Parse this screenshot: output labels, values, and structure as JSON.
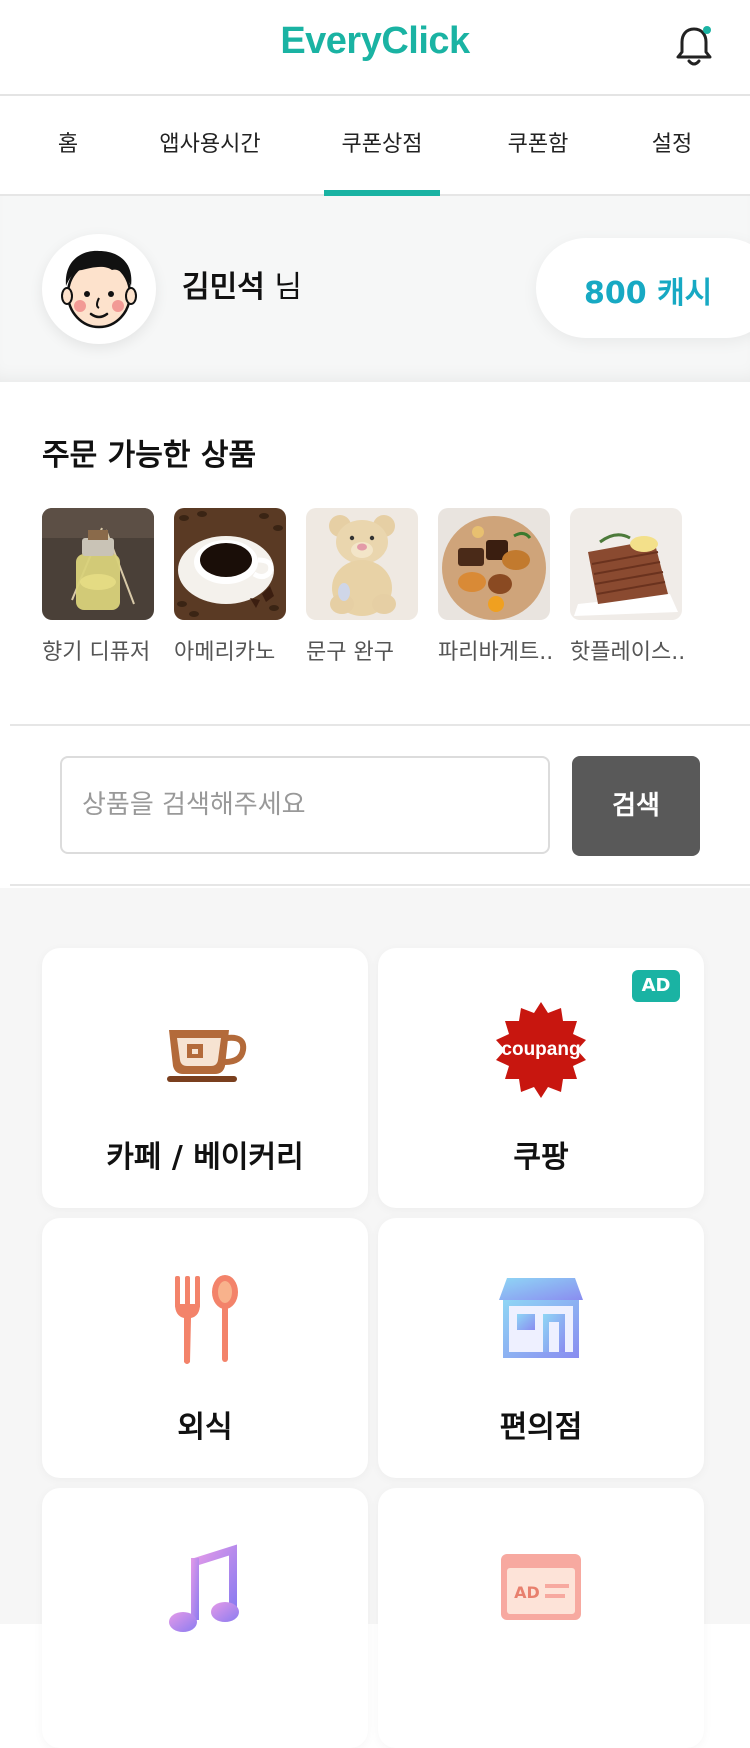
{
  "app": {
    "logo_text": "EveryClick",
    "brand_color": "#1ab3a3"
  },
  "header": {
    "bell_icon": "bell-icon",
    "notification_dot": true
  },
  "tabs": [
    {
      "label": "홈",
      "active": false
    },
    {
      "label": "앱사용시간",
      "active": false
    },
    {
      "label": "쿠폰상점",
      "active": true
    },
    {
      "label": "쿠폰함",
      "active": false
    },
    {
      "label": "설정",
      "active": false
    }
  ],
  "profile": {
    "name": "김민석",
    "suffix": " 님",
    "cash": "800 캐시",
    "avatar_icon": "avatar-icon"
  },
  "products": {
    "title": "주문 가능한 상품",
    "items": [
      {
        "label": "향기 디퓨저",
        "icon": "diffuser-image"
      },
      {
        "label": "아메리카노",
        "icon": "americano-image"
      },
      {
        "label": "문구 완구",
        "icon": "teddy-bear-image"
      },
      {
        "label": "파리바게트..",
        "icon": "pastry-image"
      },
      {
        "label": "핫플레이스..",
        "icon": "cake-image"
      }
    ]
  },
  "search": {
    "placeholder": "상품을 검색해주세요",
    "button_label": "검색"
  },
  "categories": [
    {
      "label": "카페 / 베이커리",
      "icon": "coffee-cup-icon",
      "ad": false
    },
    {
      "label": "쿠팡",
      "icon": "coupang-logo",
      "ad": true,
      "ad_label": "AD",
      "logo_text": "coupang"
    },
    {
      "label": "외식",
      "icon": "fork-spoon-icon",
      "ad": false
    },
    {
      "label": "편의점",
      "icon": "store-icon",
      "ad": false
    },
    {
      "label": "",
      "icon": "music-note-icon",
      "ad": false
    },
    {
      "label": "",
      "icon": "ad-board-icon",
      "ad": false,
      "icon_text": "AD"
    }
  ]
}
